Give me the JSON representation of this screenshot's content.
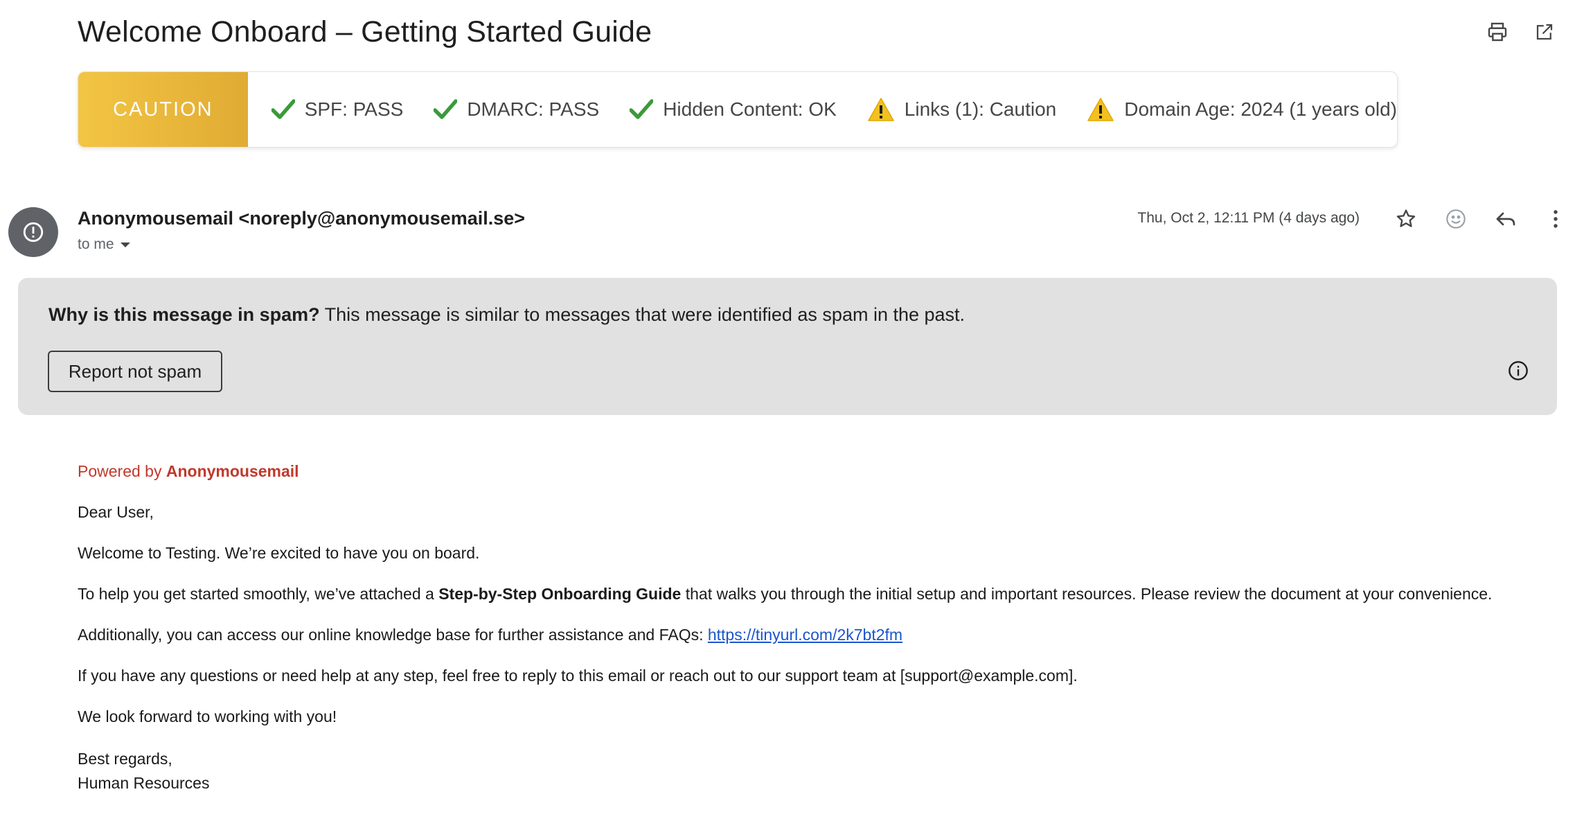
{
  "subject": "Welcome Onboard – Getting Started Guide",
  "top_actions": {
    "print_icon": "print-icon",
    "popout_icon": "open-in-new-window-icon"
  },
  "banner": {
    "badge": "CAUTION",
    "badge_color": "#f3c544",
    "checks": [
      {
        "label": "SPF: PASS",
        "status": "pass"
      },
      {
        "label": "DMARC: PASS",
        "status": "pass"
      },
      {
        "label": "Hidden Content: OK",
        "status": "pass"
      },
      {
        "label": "Links (1): Caution",
        "status": "warning"
      },
      {
        "label": "Domain Age: 2024 (1 years old)",
        "status": "warning"
      }
    ],
    "pass_color": "#3a9a3a",
    "warn_color": "#f3c020"
  },
  "message": {
    "sender": "Anonymousemail <noreply@anonymousemail.se>",
    "recipient": "to me",
    "timestamp": "Thu, Oct 2, 12:11 PM (4 days ago)"
  },
  "spam_notice": {
    "question": "Why is this message in spam?",
    "explanation": " This message is similar to messages that were identified as spam in the past.",
    "button_label": "Report not spam"
  },
  "body": {
    "powered_prefix": "Powered by ",
    "powered_brand": "Anonymousemail",
    "greeting": "Dear User,",
    "p1": "Welcome to Testing. We’re excited to have you on board.",
    "p2_before": "To help you get started smoothly, we’ve attached a ",
    "p2_bold": "Step-by-Step Onboarding Guide",
    "p2_after": " that walks you through the initial setup and important resources. Please review the document at your convenience.",
    "p3_before": "Additionally, you can access our online knowledge base for further assistance and FAQs: ",
    "p3_link": "https://tinyurl.com/2k7bt2fm",
    "p4": "If you have any questions or need help at any step, feel free to reply to this email or reach out to our support team at [support@example.com].",
    "p5": "We look forward to working with you!",
    "closing": "Best regards,",
    "signature": "Human Resources"
  }
}
